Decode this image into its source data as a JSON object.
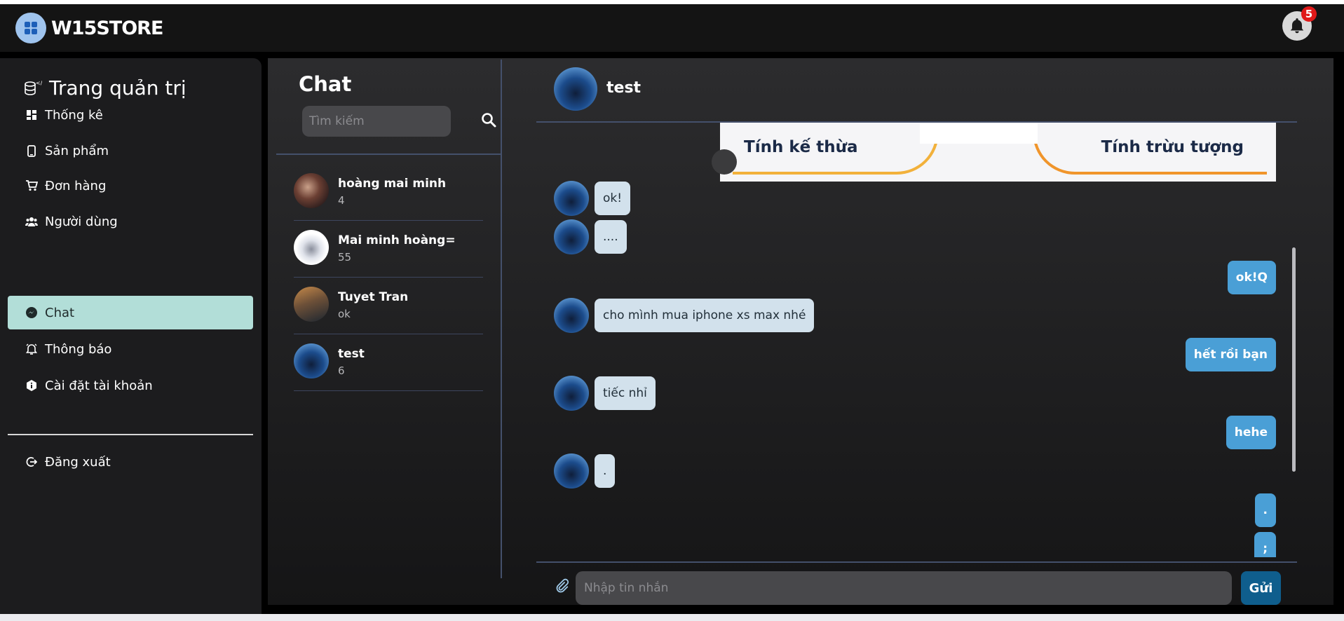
{
  "app": {
    "brand": "W15STORE",
    "notification_count": "5"
  },
  "sidebar": {
    "title": "Trang quản trị",
    "items": [
      {
        "label": "Thống kê",
        "icon": "dashboard-icon"
      },
      {
        "label": "Sản phẩm",
        "icon": "phone-icon"
      },
      {
        "label": "Đơn hàng",
        "icon": "cart-icon"
      },
      {
        "label": "Người dùng",
        "icon": "users-icon"
      },
      {
        "label": "Chat",
        "icon": "messenger-icon",
        "active": true
      },
      {
        "label": "Thông báo",
        "icon": "bell-icon"
      },
      {
        "label": "Cài đặt tài khoản",
        "icon": "info-icon"
      }
    ],
    "logout": "Đăng xuất"
  },
  "chat": {
    "heading": "Chat",
    "search_placeholder": "Tìm kiếm",
    "contacts": [
      {
        "name": "hoàng mai minh",
        "sub": "4"
      },
      {
        "name": "Mai minh hoàng=",
        "sub": "55"
      },
      {
        "name": "Tuyet Tran",
        "sub": "ok"
      },
      {
        "name": "test",
        "sub": "6"
      }
    ]
  },
  "conversation": {
    "name": "test",
    "image_labels": {
      "left": "Tính kế thừa",
      "right": "Tính trừu tượng"
    },
    "messages": [
      {
        "dir": "in",
        "text": "ok!"
      },
      {
        "dir": "in",
        "text": "...."
      },
      {
        "dir": "out",
        "text": "ok!Q"
      },
      {
        "dir": "in",
        "text": "cho mình mua iphone xs max nhé"
      },
      {
        "dir": "out",
        "text": "hết rồi bạn"
      },
      {
        "dir": "in",
        "text": "tiếc nhỉ"
      },
      {
        "dir": "out",
        "text": "hehe"
      },
      {
        "dir": "in",
        "text": "."
      },
      {
        "dir": "out",
        "text": "."
      },
      {
        "dir": "out",
        "text": ";"
      }
    ],
    "input_placeholder": "Nhập tin nhắn",
    "send_label": "Gửi"
  },
  "colors": {
    "accent_active": "#b2ded8",
    "bubble_in": "#d2e1ec",
    "bubble_out": "#4a9fd6",
    "send_button": "#0f5e8d",
    "badge": "#e01919"
  }
}
